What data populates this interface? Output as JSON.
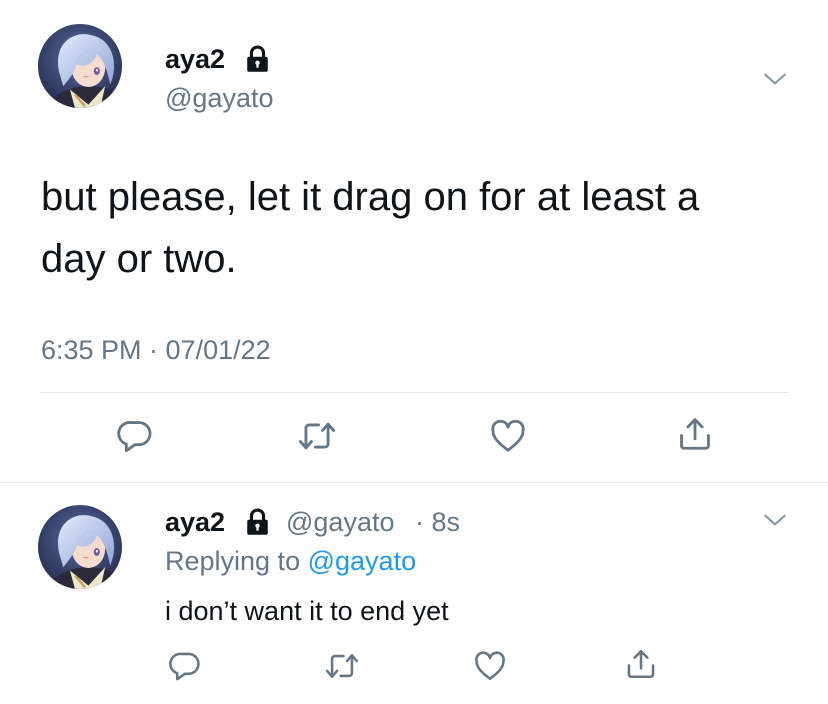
{
  "tweet": {
    "display_name": "aya2",
    "handle": "@gayato",
    "text": "but please, let it drag on for at least a day or two.",
    "timestamp": "6:35 PM · 07/01/22",
    "protected_icon": "lock-icon",
    "menu_icon": "chevron-down-icon",
    "actions": [
      "reply-icon",
      "retweet-icon",
      "like-icon",
      "share-icon"
    ]
  },
  "reply": {
    "display_name": "aya2",
    "handle": "@gayato",
    "age": "· 8s",
    "replying_prefix": "Replying to",
    "replying_to": "@gayato",
    "text": "i don’t want it to end yet",
    "protected_icon": "lock-icon",
    "menu_icon": "chevron-down-icon",
    "actions": [
      "reply-icon",
      "retweet-icon",
      "like-icon",
      "share-icon"
    ]
  },
  "colors": {
    "text": "#0f1419",
    "secondary": "#657786",
    "link": "#1d9bf0",
    "divider": "#e1e8ed"
  }
}
